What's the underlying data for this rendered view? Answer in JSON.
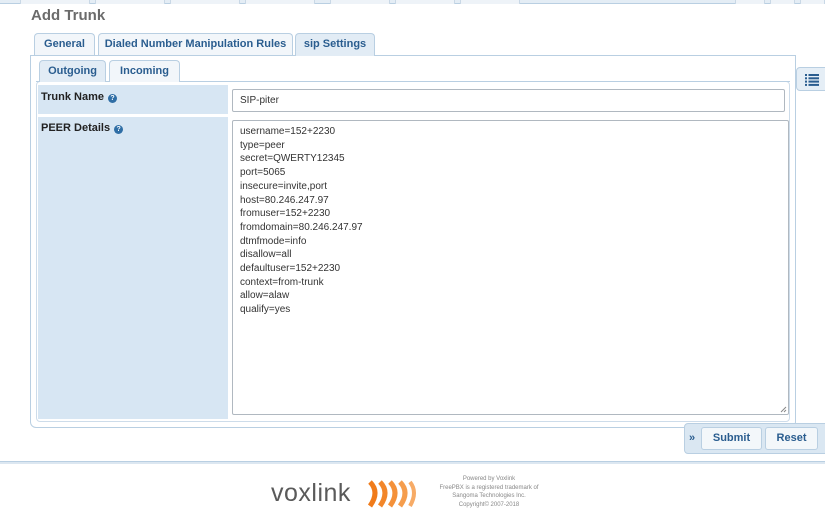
{
  "page": {
    "title": "Add Trunk"
  },
  "tabs": [
    {
      "label": "General"
    },
    {
      "label": "Dialed Number Manipulation Rules"
    },
    {
      "label": "sip Settings"
    }
  ],
  "subtabs": [
    {
      "label": "Outgoing"
    },
    {
      "label": "Incoming"
    }
  ],
  "form": {
    "trunk_name": {
      "label": "Trunk Name",
      "value": "SIP-piter"
    },
    "peer_details": {
      "label": "PEER Details",
      "lines": [
        "username=152+2230",
        "type=peer",
        "secret=QWERTY12345",
        "port=5065",
        "insecure=invite,port",
        "host=80.246.247.97",
        "fromuser=152+2230",
        "fromdomain=80.246.247.97",
        "dtmfmode=info",
        "disallow=all",
        "defaultuser=152+2230",
        "context=from-trunk",
        "allow=alaw",
        "qualify=yes"
      ]
    }
  },
  "actions": {
    "submit_label": "Submit",
    "reset_label": "Reset"
  },
  "footer": {
    "logo_text": "voxlink",
    "lines": [
      "Powered by Voxlink",
      "FreePBX is a registered trademark of",
      "Sangoma Technologies Inc.",
      "Copyright© 2007-2018"
    ]
  },
  "colors": {
    "accent": "#2a5d8f",
    "label_bg": "#d7e6f3",
    "logo_orange": "#f07b1a"
  }
}
